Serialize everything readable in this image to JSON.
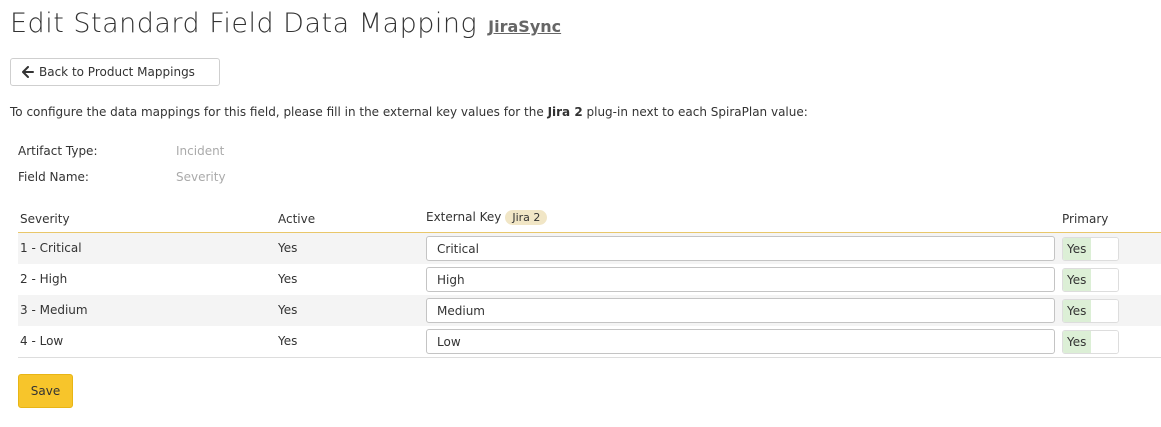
{
  "header": {
    "title": "Edit Standard Field Data Mapping",
    "plugin_link": "JiraSync"
  },
  "toolbar": {
    "back_label": "Back to Product Mappings",
    "back_icon": "arrow-left-icon"
  },
  "intro": {
    "before": "To configure the data mappings for this field, please fill in the external key values for the ",
    "plugin": "Jira 2",
    "after": " plug-in next to each SpiraPlan value:"
  },
  "properties": {
    "artifact_type_label": "Artifact Type:",
    "artifact_type_value": "Incident",
    "field_name_label": "Field Name:",
    "field_name_value": "Severity"
  },
  "grid": {
    "columns": {
      "severity": "Severity",
      "active": "Active",
      "external_key": "External Key",
      "external_key_badge": "Jira 2",
      "primary": "Primary"
    },
    "rows": [
      {
        "severity": "1 - Critical",
        "active": "Yes",
        "external_key": "Critical",
        "primary": "Yes"
      },
      {
        "severity": "2 - High",
        "active": "Yes",
        "external_key": "High",
        "primary": "Yes"
      },
      {
        "severity": "3 - Medium",
        "active": "Yes",
        "external_key": "Medium",
        "primary": "Yes"
      },
      {
        "severity": "4 - Low",
        "active": "Yes",
        "external_key": "Low",
        "primary": "Yes"
      }
    ]
  },
  "actions": {
    "save_label": "Save"
  },
  "colors": {
    "accent": "#f7c52b",
    "toggle_on": "#dcefd6",
    "header_border": "#e9c76a",
    "badge": "#f1e6c6"
  }
}
